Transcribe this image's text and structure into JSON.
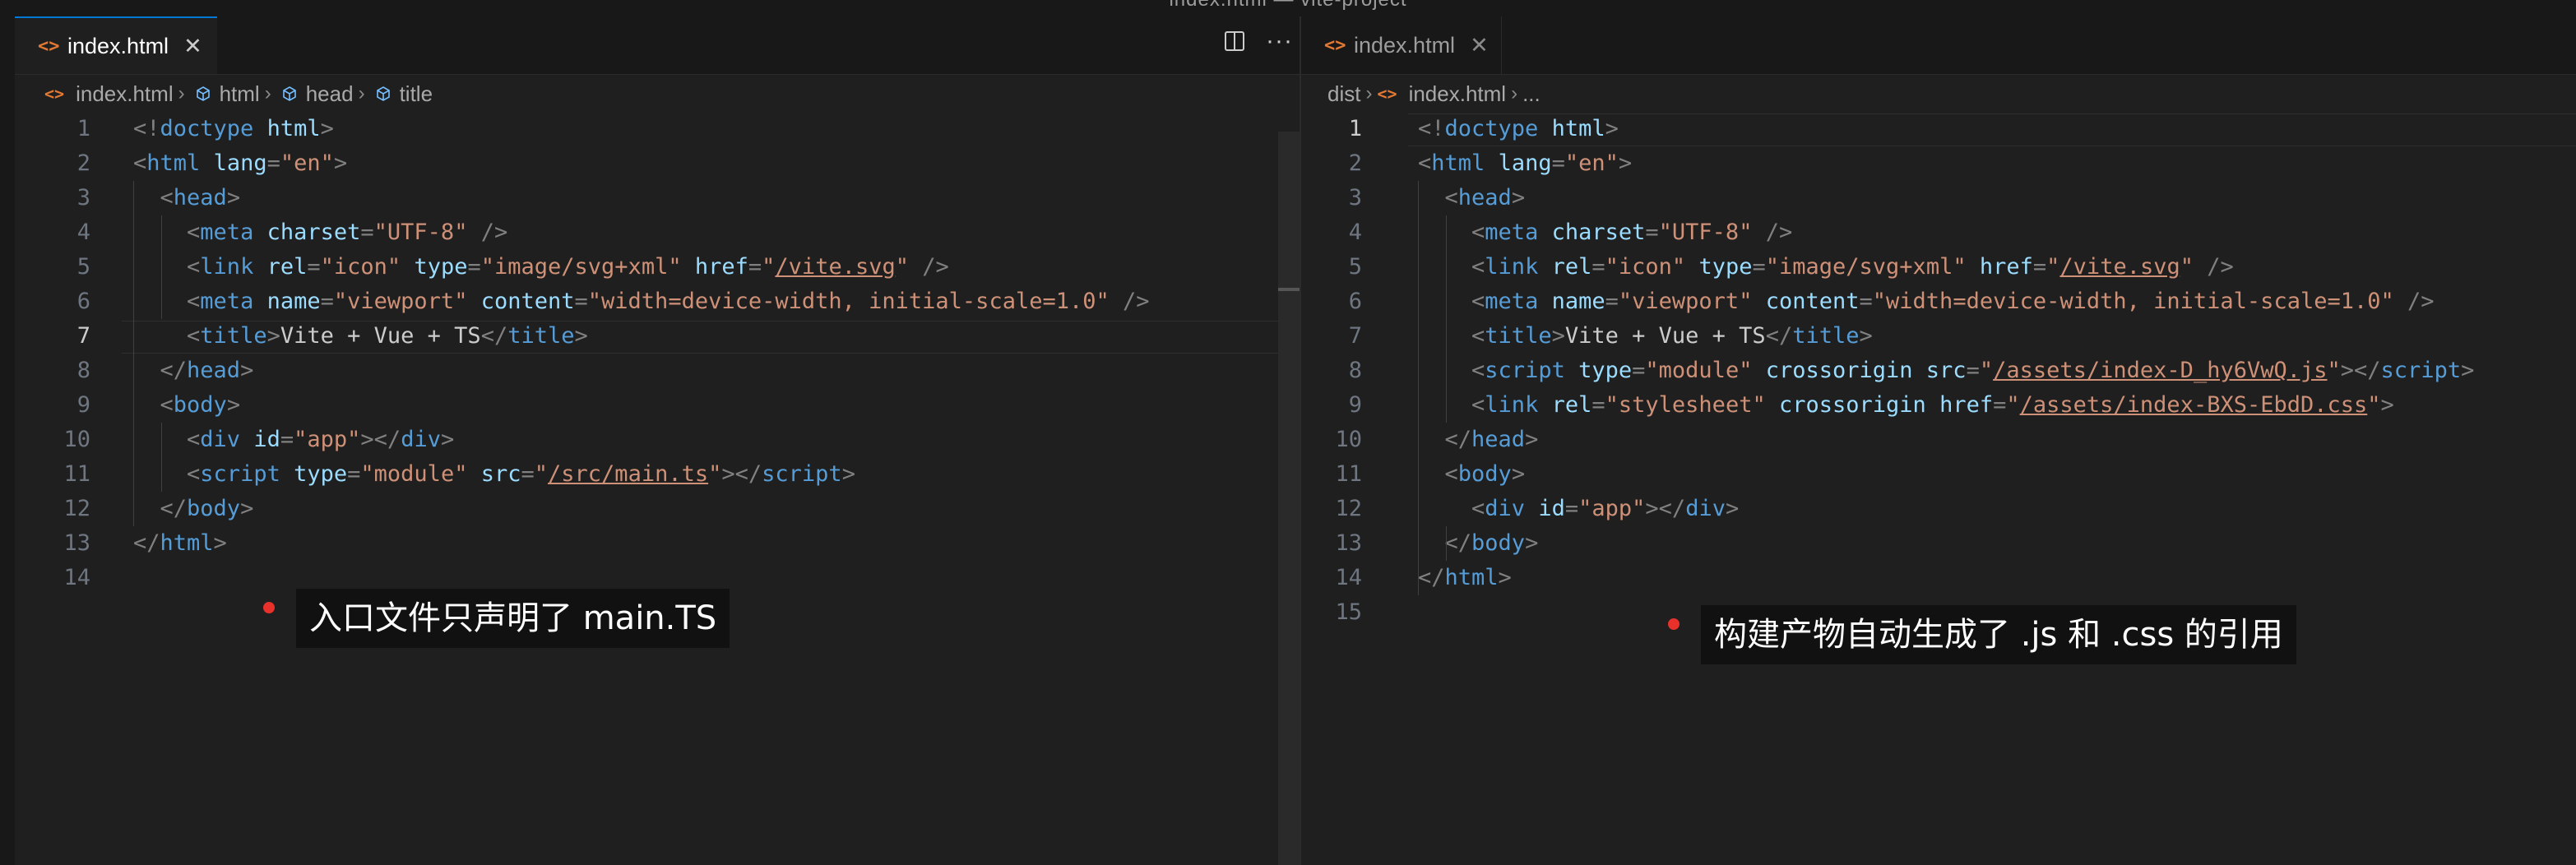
{
  "window_title": "index.html — vite-project",
  "left": {
    "tab": {
      "icon": "html-file-icon",
      "label": "index.html"
    },
    "breadcrumb": [
      "index.html",
      "html",
      "head",
      "title"
    ],
    "active_line": 7,
    "lines": [
      [
        [
          "pun",
          "<!"
        ],
        [
          "tag",
          "doctype"
        ],
        [
          "txt",
          " "
        ],
        [
          "attr",
          "html"
        ],
        [
          "pun",
          ">"
        ]
      ],
      [
        [
          "pun",
          "<"
        ],
        [
          "tag",
          "html"
        ],
        [
          "txt",
          " "
        ],
        [
          "attr",
          "lang"
        ],
        [
          "pun",
          "="
        ],
        [
          "str",
          "\"en\""
        ],
        [
          "pun",
          ">"
        ]
      ],
      [
        [
          "txt",
          "  "
        ],
        [
          "pun",
          "<"
        ],
        [
          "tag",
          "head"
        ],
        [
          "pun",
          ">"
        ]
      ],
      [
        [
          "txt",
          "    "
        ],
        [
          "pun",
          "<"
        ],
        [
          "tag",
          "meta"
        ],
        [
          "txt",
          " "
        ],
        [
          "attr",
          "charset"
        ],
        [
          "pun",
          "="
        ],
        [
          "str",
          "\"UTF-8\""
        ],
        [
          "txt",
          " "
        ],
        [
          "pun",
          "/>"
        ]
      ],
      [
        [
          "txt",
          "    "
        ],
        [
          "pun",
          "<"
        ],
        [
          "tag",
          "link"
        ],
        [
          "txt",
          " "
        ],
        [
          "attr",
          "rel"
        ],
        [
          "pun",
          "="
        ],
        [
          "str",
          "\"icon\""
        ],
        [
          "txt",
          " "
        ],
        [
          "attr",
          "type"
        ],
        [
          "pun",
          "="
        ],
        [
          "str",
          "\"image/svg+xml\""
        ],
        [
          "txt",
          " "
        ],
        [
          "attr",
          "href"
        ],
        [
          "pun",
          "="
        ],
        [
          "str",
          "\""
        ],
        [
          "link",
          "/vite.svg"
        ],
        [
          "str",
          "\""
        ],
        [
          "txt",
          " "
        ],
        [
          "pun",
          "/>"
        ]
      ],
      [
        [
          "txt",
          "    "
        ],
        [
          "pun",
          "<"
        ],
        [
          "tag",
          "meta"
        ],
        [
          "txt",
          " "
        ],
        [
          "attr",
          "name"
        ],
        [
          "pun",
          "="
        ],
        [
          "str",
          "\"viewport\""
        ],
        [
          "txt",
          " "
        ],
        [
          "attr",
          "content"
        ],
        [
          "pun",
          "="
        ],
        [
          "str",
          "\"width=device-width, initial-scale=1.0\""
        ],
        [
          "txt",
          " "
        ],
        [
          "pun",
          "/>"
        ]
      ],
      [
        [
          "txt",
          "    "
        ],
        [
          "pun",
          "<"
        ],
        [
          "tag",
          "title"
        ],
        [
          "pun",
          ">"
        ],
        [
          "txt",
          "Vite + Vue + TS"
        ],
        [
          "pun",
          "</"
        ],
        [
          "tag",
          "title"
        ],
        [
          "pun",
          ">"
        ]
      ],
      [
        [
          "txt",
          "  "
        ],
        [
          "pun",
          "</"
        ],
        [
          "tag",
          "head"
        ],
        [
          "pun",
          ">"
        ]
      ],
      [
        [
          "txt",
          "  "
        ],
        [
          "pun",
          "<"
        ],
        [
          "tag",
          "body"
        ],
        [
          "pun",
          ">"
        ]
      ],
      [
        [
          "txt",
          "    "
        ],
        [
          "pun",
          "<"
        ],
        [
          "tag",
          "div"
        ],
        [
          "txt",
          " "
        ],
        [
          "attr",
          "id"
        ],
        [
          "pun",
          "="
        ],
        [
          "str",
          "\"app\""
        ],
        [
          "pun",
          "></"
        ],
        [
          "tag",
          "div"
        ],
        [
          "pun",
          ">"
        ]
      ],
      [
        [
          "txt",
          "    "
        ],
        [
          "pun",
          "<"
        ],
        [
          "tag",
          "script"
        ],
        [
          "txt",
          " "
        ],
        [
          "attr",
          "type"
        ],
        [
          "pun",
          "="
        ],
        [
          "str",
          "\"module\""
        ],
        [
          "txt",
          " "
        ],
        [
          "attr",
          "src"
        ],
        [
          "pun",
          "="
        ],
        [
          "str",
          "\""
        ],
        [
          "link",
          "/src/main.ts"
        ],
        [
          "str",
          "\""
        ],
        [
          "pun",
          "></"
        ],
        [
          "tag",
          "script"
        ],
        [
          "pun",
          ">"
        ]
      ],
      [
        [
          "txt",
          "  "
        ],
        [
          "pun",
          "</"
        ],
        [
          "tag",
          "body"
        ],
        [
          "pun",
          ">"
        ]
      ],
      [
        [
          "pun",
          "</"
        ],
        [
          "tag",
          "html"
        ],
        [
          "pun",
          ">"
        ]
      ],
      []
    ],
    "annotation": "入口文件只声明了 main.TS"
  },
  "right": {
    "tab": {
      "icon": "html-file-icon",
      "label": "index.html"
    },
    "breadcrumb": [
      "dist",
      "index.html",
      "..."
    ],
    "active_line": 1,
    "lines": [
      [
        [
          "pun",
          "<!"
        ],
        [
          "tag",
          "doctype"
        ],
        [
          "txt",
          " "
        ],
        [
          "attr",
          "html"
        ],
        [
          "pun",
          ">"
        ]
      ],
      [
        [
          "pun",
          "<"
        ],
        [
          "tag",
          "html"
        ],
        [
          "txt",
          " "
        ],
        [
          "attr",
          "lang"
        ],
        [
          "pun",
          "="
        ],
        [
          "str",
          "\"en\""
        ],
        [
          "pun",
          ">"
        ]
      ],
      [
        [
          "txt",
          "  "
        ],
        [
          "pun",
          "<"
        ],
        [
          "tag",
          "head"
        ],
        [
          "pun",
          ">"
        ]
      ],
      [
        [
          "txt",
          "    "
        ],
        [
          "pun",
          "<"
        ],
        [
          "tag",
          "meta"
        ],
        [
          "txt",
          " "
        ],
        [
          "attr",
          "charset"
        ],
        [
          "pun",
          "="
        ],
        [
          "str",
          "\"UTF-8\""
        ],
        [
          "txt",
          " "
        ],
        [
          "pun",
          "/>"
        ]
      ],
      [
        [
          "txt",
          "    "
        ],
        [
          "pun",
          "<"
        ],
        [
          "tag",
          "link"
        ],
        [
          "txt",
          " "
        ],
        [
          "attr",
          "rel"
        ],
        [
          "pun",
          "="
        ],
        [
          "str",
          "\"icon\""
        ],
        [
          "txt",
          " "
        ],
        [
          "attr",
          "type"
        ],
        [
          "pun",
          "="
        ],
        [
          "str",
          "\"image/svg+xml\""
        ],
        [
          "txt",
          " "
        ],
        [
          "attr",
          "href"
        ],
        [
          "pun",
          "="
        ],
        [
          "str",
          "\""
        ],
        [
          "link",
          "/vite.svg"
        ],
        [
          "str",
          "\""
        ],
        [
          "txt",
          " "
        ],
        [
          "pun",
          "/>"
        ]
      ],
      [
        [
          "txt",
          "    "
        ],
        [
          "pun",
          "<"
        ],
        [
          "tag",
          "meta"
        ],
        [
          "txt",
          " "
        ],
        [
          "attr",
          "name"
        ],
        [
          "pun",
          "="
        ],
        [
          "str",
          "\"viewport\""
        ],
        [
          "txt",
          " "
        ],
        [
          "attr",
          "content"
        ],
        [
          "pun",
          "="
        ],
        [
          "str",
          "\"width=device-width, initial-scale=1.0\""
        ],
        [
          "txt",
          " "
        ],
        [
          "pun",
          "/>"
        ]
      ],
      [
        [
          "txt",
          "    "
        ],
        [
          "pun",
          "<"
        ],
        [
          "tag",
          "title"
        ],
        [
          "pun",
          ">"
        ],
        [
          "txt",
          "Vite + Vue + TS"
        ],
        [
          "pun",
          "</"
        ],
        [
          "tag",
          "title"
        ],
        [
          "pun",
          ">"
        ]
      ],
      [
        [
          "txt",
          "    "
        ],
        [
          "pun",
          "<"
        ],
        [
          "tag",
          "script"
        ],
        [
          "txt",
          " "
        ],
        [
          "attr",
          "type"
        ],
        [
          "pun",
          "="
        ],
        [
          "str",
          "\"module\""
        ],
        [
          "txt",
          " "
        ],
        [
          "attr",
          "crossorigin"
        ],
        [
          "txt",
          " "
        ],
        [
          "attr",
          "src"
        ],
        [
          "pun",
          "="
        ],
        [
          "str",
          "\""
        ],
        [
          "link",
          "/assets/index-D_hy6VwQ.js"
        ],
        [
          "str",
          "\""
        ],
        [
          "pun",
          "></"
        ],
        [
          "tag",
          "script"
        ],
        [
          "pun",
          ">"
        ]
      ],
      [
        [
          "txt",
          "    "
        ],
        [
          "pun",
          "<"
        ],
        [
          "tag",
          "link"
        ],
        [
          "txt",
          " "
        ],
        [
          "attr",
          "rel"
        ],
        [
          "pun",
          "="
        ],
        [
          "str",
          "\"stylesheet\""
        ],
        [
          "txt",
          " "
        ],
        [
          "attr",
          "crossorigin"
        ],
        [
          "txt",
          " "
        ],
        [
          "attr",
          "href"
        ],
        [
          "pun",
          "="
        ],
        [
          "str",
          "\""
        ],
        [
          "link",
          "/assets/index-BXS-EbdD.css"
        ],
        [
          "str",
          "\""
        ],
        [
          "pun",
          ">"
        ]
      ],
      [
        [
          "txt",
          "  "
        ],
        [
          "pun",
          "</"
        ],
        [
          "tag",
          "head"
        ],
        [
          "pun",
          ">"
        ]
      ],
      [
        [
          "txt",
          "  "
        ],
        [
          "pun",
          "<"
        ],
        [
          "tag",
          "body"
        ],
        [
          "pun",
          ">"
        ]
      ],
      [
        [
          "txt",
          "    "
        ],
        [
          "pun",
          "<"
        ],
        [
          "tag",
          "div"
        ],
        [
          "txt",
          " "
        ],
        [
          "attr",
          "id"
        ],
        [
          "pun",
          "="
        ],
        [
          "str",
          "\"app\""
        ],
        [
          "pun",
          "></"
        ],
        [
          "tag",
          "div"
        ],
        [
          "pun",
          ">"
        ]
      ],
      [
        [
          "txt",
          "  "
        ],
        [
          "pun",
          "</"
        ],
        [
          "tag",
          "body"
        ],
        [
          "pun",
          ">"
        ]
      ],
      [
        [
          "pun",
          "</"
        ],
        [
          "tag",
          "html"
        ],
        [
          "pun",
          ">"
        ]
      ],
      []
    ],
    "annotation": "构建产物自动生成了 .js 和 .css 的引用"
  }
}
